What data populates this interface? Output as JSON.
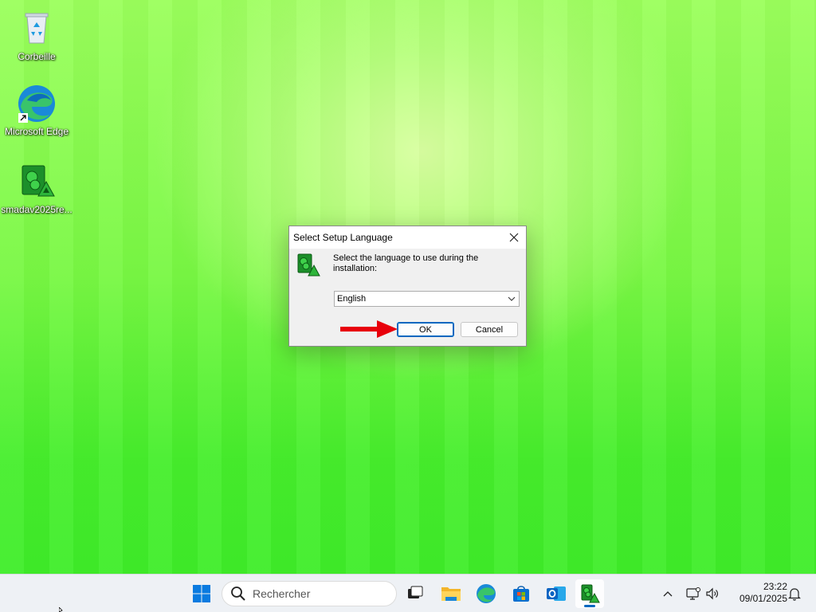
{
  "desktop": {
    "icons": [
      {
        "label": "Corbeille",
        "icon": "recycle-bin-icon"
      },
      {
        "label": "Microsoft Edge",
        "icon": "edge-icon"
      },
      {
        "label": "smadav2025re...",
        "icon": "smadav-installer-icon"
      }
    ]
  },
  "dialog": {
    "title": "Select Setup Language",
    "message": "Select the language to use during the installation:",
    "language_select": {
      "value": "English"
    },
    "ok_label": "OK",
    "cancel_label": "Cancel",
    "annotation_arrow_color": "#e8000b"
  },
  "taskbar": {
    "search_placeholder": "Rechercher",
    "apps": [
      "start-icon",
      "task-view-icon",
      "file-explorer-icon",
      "edge-icon",
      "store-icon",
      "outlook-icon",
      "smadav-installer-icon"
    ],
    "clock": {
      "time": "23:22",
      "date": "09/01/2025"
    }
  },
  "colors": {
    "accent": "#0067c0",
    "wallpaper": "#5cf23a"
  }
}
